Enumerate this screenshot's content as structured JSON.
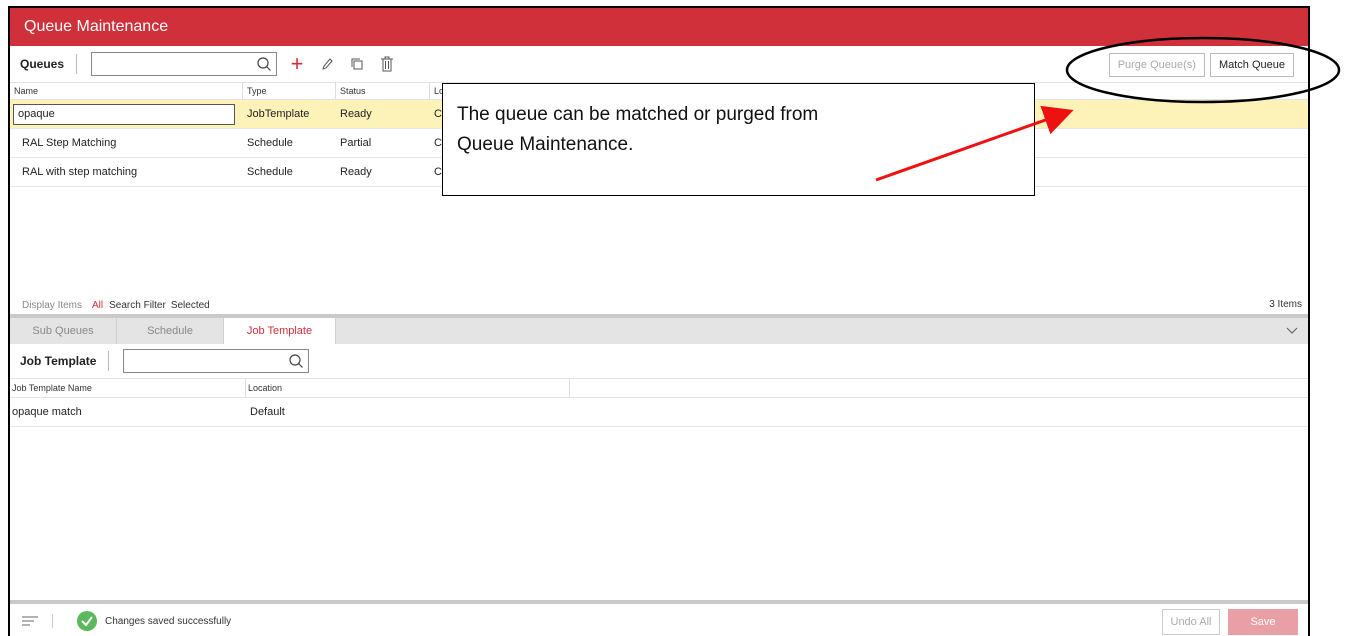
{
  "window": {
    "title": "Queue Maintenance"
  },
  "queues": {
    "label": "Queues",
    "search_value": "",
    "buttons": {
      "purge": "Purge Queue(s)",
      "match": "Match Queue"
    },
    "columns": [
      "Name",
      "Type",
      "Status",
      "Lo"
    ],
    "rows": [
      {
        "name": "opaque",
        "type": "JobTemplate",
        "status": "Ready",
        "loc": "C"
      },
      {
        "name": "RAL Step Matching",
        "type": "Schedule",
        "status": "Partial",
        "loc": "C"
      },
      {
        "name": "RAL with step matching",
        "type": "Schedule",
        "status": "Ready",
        "loc": "C"
      }
    ],
    "display": {
      "label": "Display Items",
      "all": "All",
      "search_filter": "Search Filter",
      "selected": "Selected",
      "count": "3 Items"
    }
  },
  "tabs": [
    "Sub Queues",
    "Schedule",
    "Job Template"
  ],
  "job_template": {
    "label": "Job Template",
    "search_value": "",
    "columns": [
      "Job Template Name",
      "Location"
    ],
    "rows": [
      {
        "name": "opaque match",
        "location": "Default"
      }
    ]
  },
  "footer": {
    "message": "Changes saved successfully",
    "undo": "Undo All",
    "save": "Save"
  },
  "callout": {
    "line1": "The queue can be matched or purged from",
    "line2": "Queue Maintenance."
  },
  "colors": {
    "brand_red": "#d0303a",
    "selected_row": "#fdf3b8",
    "success_green": "#5cb85c",
    "arrow_red": "#ee1111"
  }
}
